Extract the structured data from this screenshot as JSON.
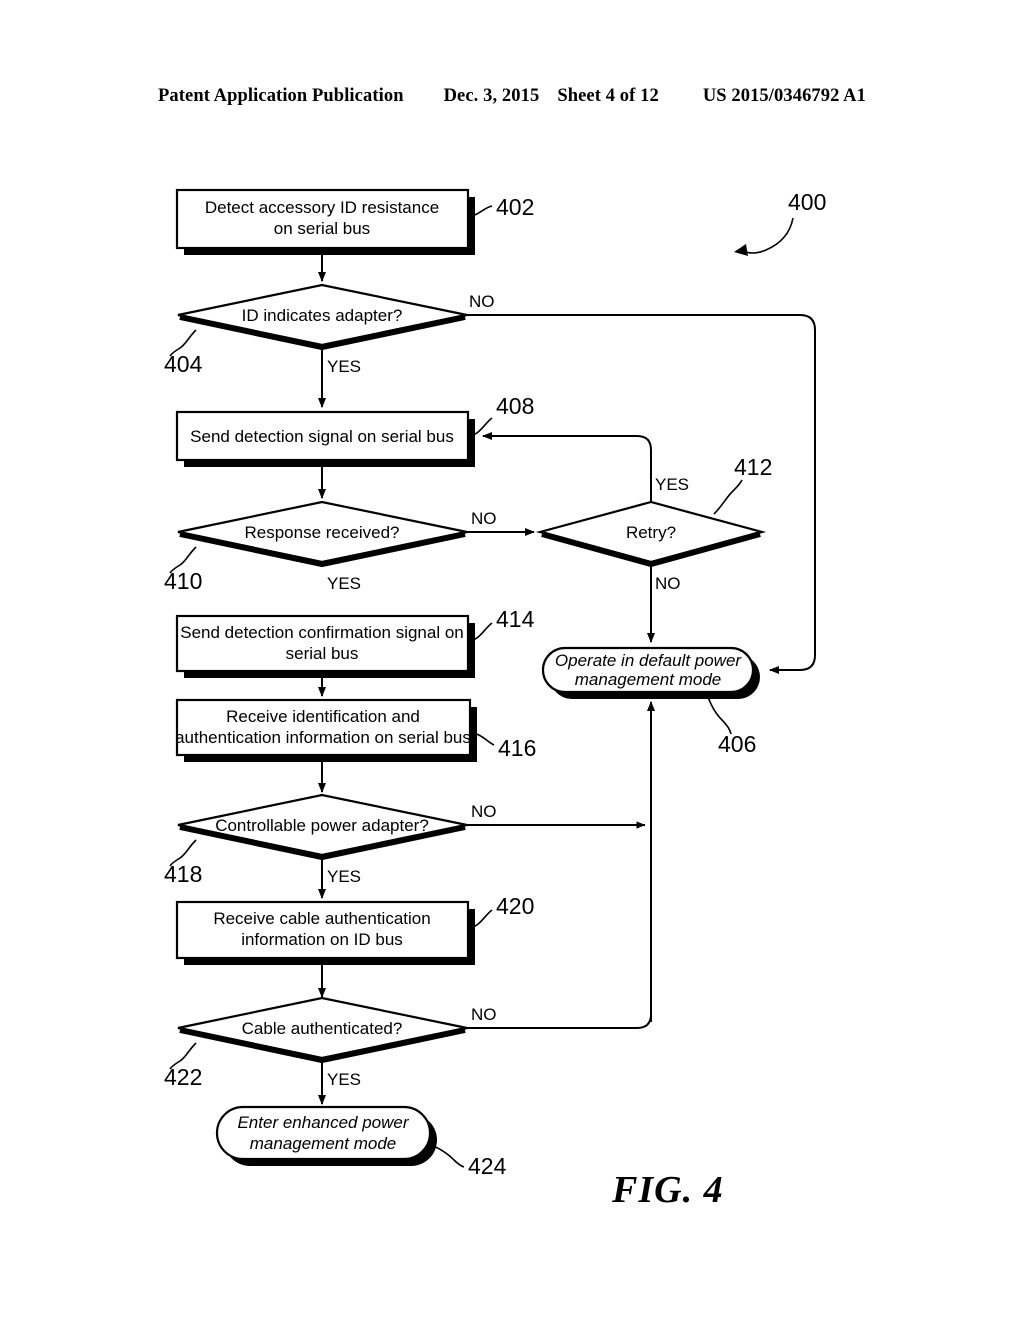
{
  "header": {
    "publication": "Patent Application Publication",
    "date": "Dec. 3, 2015",
    "sheet": "Sheet 4 of 12",
    "document_number": "US 2015/0346792 A1"
  },
  "figure": {
    "caption": "FIG. 4",
    "diagram_ref": "400"
  },
  "nodes": [
    {
      "ref": "402",
      "type": "process",
      "text_line1": "Detect accessory ID resistance",
      "text_line2": "on serial bus"
    },
    {
      "ref": "404",
      "type": "decision",
      "text_line1": "ID indicates adapter?",
      "text_line2": ""
    },
    {
      "ref": "406",
      "type": "terminal",
      "text_line1": "Operate in default power",
      "text_line2": "management mode"
    },
    {
      "ref": "408",
      "type": "process",
      "text_line1": "Send detection signal on serial bus",
      "text_line2": ""
    },
    {
      "ref": "410",
      "type": "decision",
      "text_line1": "Response received?",
      "text_line2": ""
    },
    {
      "ref": "412",
      "type": "decision",
      "text_line1": "Retry?",
      "text_line2": ""
    },
    {
      "ref": "414",
      "type": "process",
      "text_line1": "Send detection confirmation signal on",
      "text_line2": "serial bus"
    },
    {
      "ref": "416",
      "type": "process",
      "text_line1": "Receive identification and",
      "text_line2": "authentication information on serial bus"
    },
    {
      "ref": "418",
      "type": "decision",
      "text_line1": "Controllable power adapter?",
      "text_line2": ""
    },
    {
      "ref": "420",
      "type": "process",
      "text_line1": "Receive cable authentication",
      "text_line2": "information on ID bus"
    },
    {
      "ref": "422",
      "type": "decision",
      "text_line1": "Cable authenticated?",
      "text_line2": ""
    },
    {
      "ref": "424",
      "type": "terminal",
      "text_line1": "Enter enhanced power",
      "text_line2": "management mode"
    }
  ],
  "branches": {
    "d404_no": "NO",
    "d404_yes": "YES",
    "d410_no": "NO",
    "d410_yes": "YES",
    "d412_yes": "YES",
    "d412_no": "NO",
    "d418_no": "NO",
    "d418_yes": "YES",
    "d422_no": "NO",
    "d422_yes": "YES"
  },
  "colors": {
    "ink": "#000000",
    "paper": "#ffffff"
  }
}
